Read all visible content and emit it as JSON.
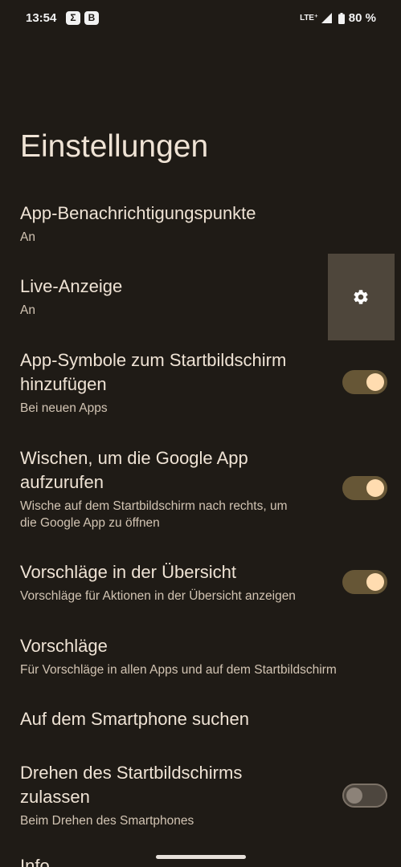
{
  "status_bar": {
    "time": "13:54",
    "notifications": [
      {
        "icon": "sigma-icon",
        "glyph": "Σ"
      },
      {
        "icon": "b-app-icon",
        "glyph": "B"
      }
    ],
    "network": "LTE⁺",
    "battery": "80 %"
  },
  "page": {
    "title": "Einstellungen"
  },
  "settings": [
    {
      "title": "App-Benachrichtigungspunkte",
      "summary": "An"
    },
    {
      "title": "Live-Anzeige",
      "summary": "An"
    },
    {
      "title_lines": [
        "App-Symbole zum Startbildschirm",
        "hinzufügen"
      ],
      "summary": "Bei neuen Apps",
      "toggle": "on"
    },
    {
      "title_lines": [
        "Wischen, um die Google App",
        "aufzurufen"
      ],
      "summary_lines": [
        "Wische auf dem Startbildschirm nach rechts, um",
        "die Google App zu öffnen"
      ],
      "toggle": "on"
    },
    {
      "title": "Vorschläge in der Übersicht",
      "summary": "Vorschläge für Aktionen in der Übersicht anzeigen",
      "toggle": "on"
    },
    {
      "title": "Vorschläge",
      "summary": "Für Vorschläge in allen Apps und auf dem Startbildschirm"
    },
    {
      "title": "Auf dem Smartphone suchen"
    },
    {
      "title_lines": [
        "Drehen des Startbildschirms",
        "zulassen"
      ],
      "summary": "Beim Drehen des Smartphones",
      "toggle": "off"
    },
    {
      "title": "Info"
    }
  ],
  "colors": {
    "background": "#1f1b16",
    "toggle_on_track": "#665636",
    "toggle_on_thumb": "#ffdcb0"
  }
}
